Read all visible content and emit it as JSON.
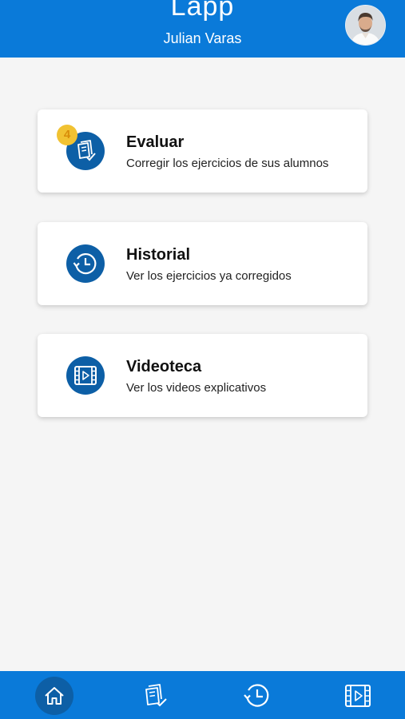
{
  "header": {
    "app_title": "Lapp",
    "user_name": "Julian Varas"
  },
  "cards": [
    {
      "title": "Evaluar",
      "subtitle": "Corregir los ejercicios de sus alumnos",
      "icon": "evaluate-icon",
      "badge": "4"
    },
    {
      "title": "Historial",
      "subtitle": "Ver los ejercicios ya corregidos",
      "icon": "history-icon"
    },
    {
      "title": "Videoteca",
      "subtitle": "Ver los videos explicativos",
      "icon": "video-library-icon"
    }
  ],
  "bottom_nav": {
    "items": [
      "home-icon",
      "evaluate-icon",
      "history-icon",
      "video-library-icon"
    ],
    "active": "home-icon"
  },
  "colors": {
    "primary": "#0a7ad9",
    "icon_bg": "#0d5fa6",
    "badge": "#f1c232"
  }
}
